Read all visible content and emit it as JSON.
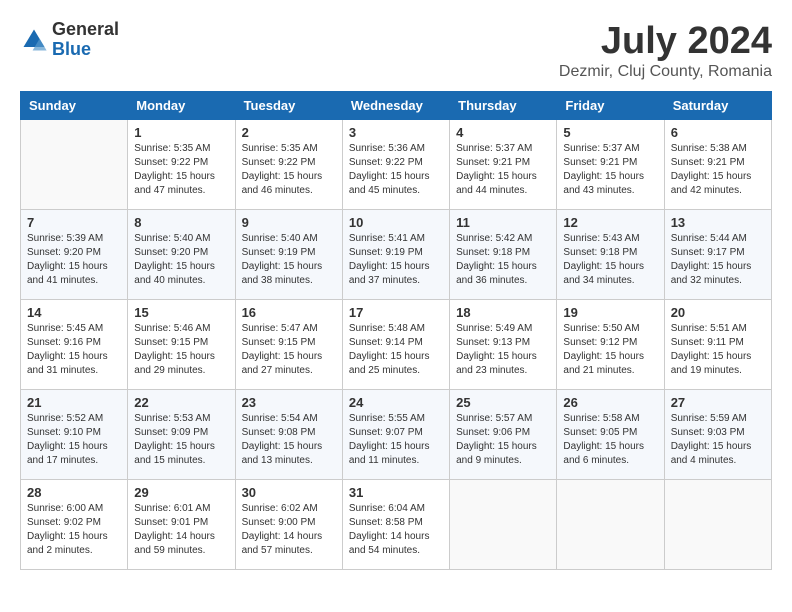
{
  "logo": {
    "general": "General",
    "blue": "Blue"
  },
  "title": {
    "month_year": "July 2024",
    "location": "Dezmir, Cluj County, Romania"
  },
  "headers": [
    "Sunday",
    "Monday",
    "Tuesday",
    "Wednesday",
    "Thursday",
    "Friday",
    "Saturday"
  ],
  "weeks": [
    [
      {
        "day": "",
        "info": ""
      },
      {
        "day": "1",
        "info": "Sunrise: 5:35 AM\nSunset: 9:22 PM\nDaylight: 15 hours\nand 47 minutes."
      },
      {
        "day": "2",
        "info": "Sunrise: 5:35 AM\nSunset: 9:22 PM\nDaylight: 15 hours\nand 46 minutes."
      },
      {
        "day": "3",
        "info": "Sunrise: 5:36 AM\nSunset: 9:22 PM\nDaylight: 15 hours\nand 45 minutes."
      },
      {
        "day": "4",
        "info": "Sunrise: 5:37 AM\nSunset: 9:21 PM\nDaylight: 15 hours\nand 44 minutes."
      },
      {
        "day": "5",
        "info": "Sunrise: 5:37 AM\nSunset: 9:21 PM\nDaylight: 15 hours\nand 43 minutes."
      },
      {
        "day": "6",
        "info": "Sunrise: 5:38 AM\nSunset: 9:21 PM\nDaylight: 15 hours\nand 42 minutes."
      }
    ],
    [
      {
        "day": "7",
        "info": "Sunrise: 5:39 AM\nSunset: 9:20 PM\nDaylight: 15 hours\nand 41 minutes."
      },
      {
        "day": "8",
        "info": "Sunrise: 5:40 AM\nSunset: 9:20 PM\nDaylight: 15 hours\nand 40 minutes."
      },
      {
        "day": "9",
        "info": "Sunrise: 5:40 AM\nSunset: 9:19 PM\nDaylight: 15 hours\nand 38 minutes."
      },
      {
        "day": "10",
        "info": "Sunrise: 5:41 AM\nSunset: 9:19 PM\nDaylight: 15 hours\nand 37 minutes."
      },
      {
        "day": "11",
        "info": "Sunrise: 5:42 AM\nSunset: 9:18 PM\nDaylight: 15 hours\nand 36 minutes."
      },
      {
        "day": "12",
        "info": "Sunrise: 5:43 AM\nSunset: 9:18 PM\nDaylight: 15 hours\nand 34 minutes."
      },
      {
        "day": "13",
        "info": "Sunrise: 5:44 AM\nSunset: 9:17 PM\nDaylight: 15 hours\nand 32 minutes."
      }
    ],
    [
      {
        "day": "14",
        "info": "Sunrise: 5:45 AM\nSunset: 9:16 PM\nDaylight: 15 hours\nand 31 minutes."
      },
      {
        "day": "15",
        "info": "Sunrise: 5:46 AM\nSunset: 9:15 PM\nDaylight: 15 hours\nand 29 minutes."
      },
      {
        "day": "16",
        "info": "Sunrise: 5:47 AM\nSunset: 9:15 PM\nDaylight: 15 hours\nand 27 minutes."
      },
      {
        "day": "17",
        "info": "Sunrise: 5:48 AM\nSunset: 9:14 PM\nDaylight: 15 hours\nand 25 minutes."
      },
      {
        "day": "18",
        "info": "Sunrise: 5:49 AM\nSunset: 9:13 PM\nDaylight: 15 hours\nand 23 minutes."
      },
      {
        "day": "19",
        "info": "Sunrise: 5:50 AM\nSunset: 9:12 PM\nDaylight: 15 hours\nand 21 minutes."
      },
      {
        "day": "20",
        "info": "Sunrise: 5:51 AM\nSunset: 9:11 PM\nDaylight: 15 hours\nand 19 minutes."
      }
    ],
    [
      {
        "day": "21",
        "info": "Sunrise: 5:52 AM\nSunset: 9:10 PM\nDaylight: 15 hours\nand 17 minutes."
      },
      {
        "day": "22",
        "info": "Sunrise: 5:53 AM\nSunset: 9:09 PM\nDaylight: 15 hours\nand 15 minutes."
      },
      {
        "day": "23",
        "info": "Sunrise: 5:54 AM\nSunset: 9:08 PM\nDaylight: 15 hours\nand 13 minutes."
      },
      {
        "day": "24",
        "info": "Sunrise: 5:55 AM\nSunset: 9:07 PM\nDaylight: 15 hours\nand 11 minutes."
      },
      {
        "day": "25",
        "info": "Sunrise: 5:57 AM\nSunset: 9:06 PM\nDaylight: 15 hours\nand 9 minutes."
      },
      {
        "day": "26",
        "info": "Sunrise: 5:58 AM\nSunset: 9:05 PM\nDaylight: 15 hours\nand 6 minutes."
      },
      {
        "day": "27",
        "info": "Sunrise: 5:59 AM\nSunset: 9:03 PM\nDaylight: 15 hours\nand 4 minutes."
      }
    ],
    [
      {
        "day": "28",
        "info": "Sunrise: 6:00 AM\nSunset: 9:02 PM\nDaylight: 15 hours\nand 2 minutes."
      },
      {
        "day": "29",
        "info": "Sunrise: 6:01 AM\nSunset: 9:01 PM\nDaylight: 14 hours\nand 59 minutes."
      },
      {
        "day": "30",
        "info": "Sunrise: 6:02 AM\nSunset: 9:00 PM\nDaylight: 14 hours\nand 57 minutes."
      },
      {
        "day": "31",
        "info": "Sunrise: 6:04 AM\nSunset: 8:58 PM\nDaylight: 14 hours\nand 54 minutes."
      },
      {
        "day": "",
        "info": ""
      },
      {
        "day": "",
        "info": ""
      },
      {
        "day": "",
        "info": ""
      }
    ]
  ]
}
